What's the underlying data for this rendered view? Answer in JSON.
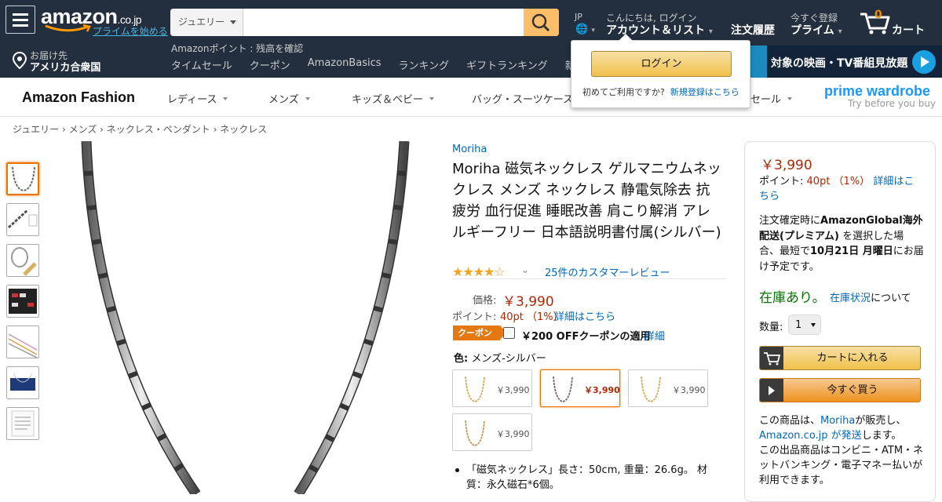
{
  "header": {
    "logo_text": "amazon",
    "logo_tld": ".co.jp",
    "prime_start": "プライムを始める",
    "search_category": "ジュエリー",
    "search_placeholder": "",
    "lang": "JP",
    "globe": "🌐",
    "greeting": "こんにちは, ログイン",
    "account_list": "アカウント＆リスト",
    "orders": "注文履歴",
    "register_now": "今すぐ登録",
    "prime": "プライム",
    "cart_count": "0",
    "cart": "カート",
    "deliver_to": "お届け先",
    "deliver_place": "アメリカ合衆国",
    "points_line": "Amazonポイント : 残高を確認",
    "nav": [
      "タイムセール",
      "クーポン",
      "AmazonBasics",
      "ランキング",
      "ギフトランキング",
      "新着"
    ],
    "banner_text": "対象の映画・TV番組見放題"
  },
  "subnav": {
    "brand": "Amazon Fashion",
    "items": [
      "レディース",
      "メンズ",
      "キッズ＆ベビー",
      "バッグ・スーツケース",
      "セール"
    ],
    "prime_wardrobe": "prime wardrobe",
    "prime_wardrobe_tag": "Try before you buy"
  },
  "breadcrumb": "ジュエリー › メンズ › ネックレス・ペンダント › ネックレス",
  "product": {
    "brand": "Moriha",
    "title": "Moriha 磁気ネックレス ゲルマニウムネックレス メンズ ネックレス 静電気除去 抗疲労 血行促進 睡眠改善 肩こり解消 アレルギーフリー 日本語説明書付属(シルバー)",
    "rating": 4.5,
    "stars": "★★★★☆",
    "reviews": "25件のカスタマーレビュー",
    "price_label": "価格:",
    "price": "￥3,990",
    "points_label": "ポイント:",
    "points_value": "40pt （1%）",
    "points_link": "詳細はこちら",
    "coupon_badge": "クーポン",
    "coupon_text": "￥200 OFFクーポンの適用",
    "coupon_link": "詳細",
    "color_label": "色:",
    "color_value": "メンズ-シルバー",
    "swatches": [
      {
        "price": "￥3,990",
        "selected": false,
        "color": "#d3a24a"
      },
      {
        "price": "￥3,990",
        "selected": true,
        "color": "#8a8e94"
      },
      {
        "price": "￥3,990",
        "selected": false,
        "color": "#d3a24a"
      },
      {
        "price": "￥3,990",
        "selected": false,
        "color": "#c68a4a"
      }
    ],
    "bullet": "「磁気ネックレス」長さ：50cm, 重量：26.6g。 材質：永久磁石*6個。"
  },
  "buybox": {
    "price": "￥3,990",
    "points_label": "ポイント:",
    "points_value": "40pt （1%）",
    "points_link": "詳細はこちら",
    "ship_pre": "注文確定時に",
    "ship_bold": "AmazonGlobal海外配送(プレミアム)",
    "ship_mid": " を選択した場合、最短で",
    "ship_date": "10月21日 月曜日",
    "ship_post": "にお届け予定です。",
    "in_stock": "在庫あり。",
    "stock_link": "在庫状況",
    "stock_post": "について",
    "qty_label": "数量:",
    "qty": "1",
    "add_to_cart": "カートに入れる",
    "buy_now": "今すぐ買う",
    "seller_pre": "この商品は、",
    "seller_name": "Moriha",
    "seller_mid": "が販売し、",
    "ships_from": "Amazon.co.jp が発送",
    "ships_post": "します。",
    "payment": "この出品商品はコンビニ・ATM・ネットバンキング・電子マネー払いが利用できます。"
  },
  "popup": {
    "login": "ログイン",
    "new_user_q": "初めてご利用ですか?",
    "register": "新規登録はこちら"
  },
  "colors": {
    "nav_bg": "#232f3e",
    "accent": "#febd69",
    "price": "#b12704",
    "link": "#0066c0",
    "stock": "#007600"
  }
}
